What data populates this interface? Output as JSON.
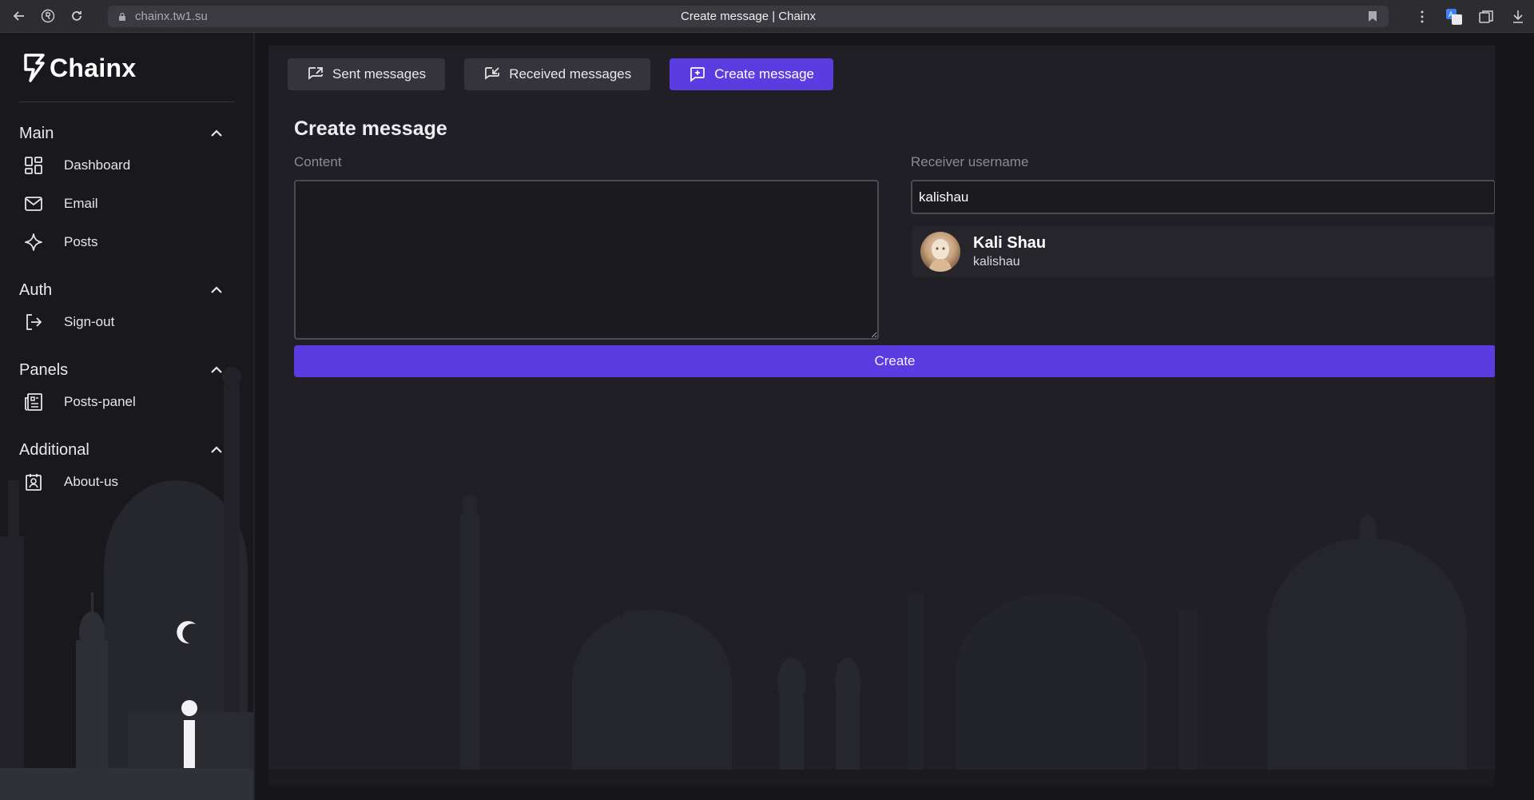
{
  "browser": {
    "url": "chainx.tw1.su",
    "title": "Create message | Chainx"
  },
  "sidebar": {
    "logo": "Chainx",
    "sections": [
      {
        "title": "Main",
        "items": [
          {
            "label": "Dashboard",
            "icon": "dashboard-icon"
          },
          {
            "label": "Email",
            "icon": "mail-icon"
          },
          {
            "label": "Posts",
            "icon": "sparkle-icon"
          }
        ]
      },
      {
        "title": "Auth",
        "items": [
          {
            "label": "Sign-out",
            "icon": "sign-out-icon"
          }
        ]
      },
      {
        "title": "Panels",
        "items": [
          {
            "label": "Posts-panel",
            "icon": "newspaper-icon"
          }
        ]
      },
      {
        "title": "Additional",
        "items": [
          {
            "label": "About-us",
            "icon": "contact-card-icon"
          }
        ]
      }
    ]
  },
  "tabs": [
    {
      "label": "Sent messages",
      "icon": "message-out-icon",
      "active": false
    },
    {
      "label": "Received messages",
      "icon": "message-in-icon",
      "active": false
    },
    {
      "label": "Create message",
      "icon": "message-plus-icon",
      "active": true
    }
  ],
  "form": {
    "title": "Create message",
    "content_label": "Content",
    "content_value": "",
    "receiver_label": "Receiver username",
    "receiver_value": "kalishau",
    "suggestion": {
      "name": "Kali Shau",
      "username": "kalishau"
    },
    "submit_label": "Create"
  },
  "colors": {
    "accent": "#5a3ce0",
    "panel": "#1f1f25",
    "sidebar": "#18181d"
  }
}
